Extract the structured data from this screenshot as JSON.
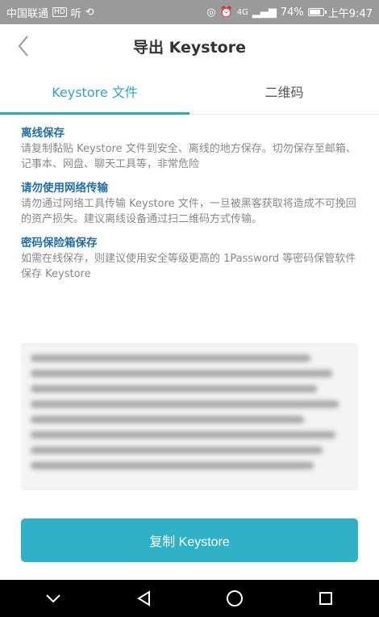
{
  "status_bar": {
    "carrier": "中国联通",
    "hd_badge": "HD",
    "ting": "听",
    "battery_pct": "74%",
    "time": "上午9:47",
    "signal": "4G"
  },
  "header": {
    "title": "导出 Keystore"
  },
  "tabs": [
    {
      "label": "Keystore 文件",
      "active": true
    },
    {
      "label": "二维码",
      "active": false
    }
  ],
  "sections": [
    {
      "title": "离线保存",
      "body": "请复制黏贴 Keystore 文件到安全、离线的地方保存。切勿保存至邮箱、记事本、网盘、聊天工具等，非常危险"
    },
    {
      "title": "请勿使用网络传输",
      "body": "请勿通过网络工具传输 Keystore 文件，一旦被黑客获取将造成不可挽回的资产损失。建议离线设备通过扫二维码方式传输。"
    },
    {
      "title": "密码保险箱保存",
      "body": "如需在线保存，则建议使用安全等级更高的 1Password 等密码保管软件保存 Keystore"
    }
  ],
  "copy_button": {
    "label": "复制 Keystore"
  },
  "colors": {
    "accent": "#2aa8bf",
    "button": "#2fb2c6",
    "section_title": "#1f6fa8"
  }
}
